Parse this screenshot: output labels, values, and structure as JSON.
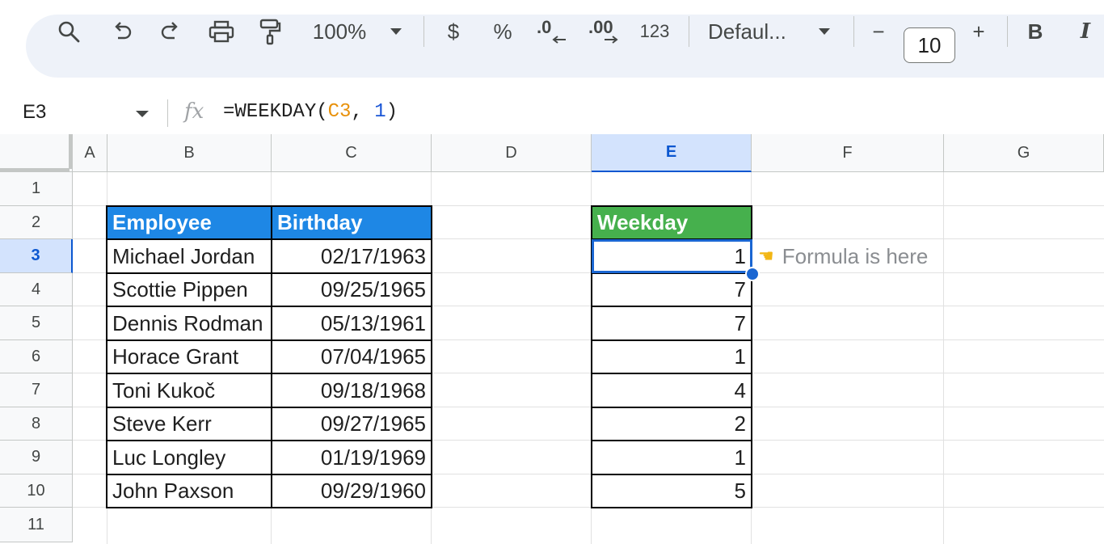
{
  "toolbar": {
    "zoom": "100%",
    "currency": "$",
    "percent": "%",
    "decrease_decimal": ".0",
    "increase_decimal": ".00",
    "number_format": "123",
    "font_family": "Defaul...",
    "minus": "−",
    "font_size": "10",
    "plus": "+",
    "bold": "B",
    "italic": "I"
  },
  "formula_bar": {
    "name_box": "E3",
    "fx": "fx",
    "formula_prefix": "=WEEKDAY(",
    "formula_ref": "C3",
    "formula_sep": ", ",
    "formula_arg": "1",
    "formula_suffix": ")"
  },
  "columns": [
    "A",
    "B",
    "C",
    "D",
    "E",
    "F",
    "G"
  ],
  "selected_column": "E",
  "rows": [
    "1",
    "2",
    "3",
    "4",
    "5",
    "6",
    "7",
    "8",
    "9",
    "10",
    "11"
  ],
  "selected_row": "3",
  "table": {
    "header_employee": "Employee",
    "header_birthday": "Birthday",
    "header_weekday": "Weekday",
    "employees": [
      "Michael Jordan",
      "Scottie Pippen",
      "Dennis Rodman",
      "Horace Grant",
      "Toni Kukoč",
      "Steve Kerr",
      "Luc Longley",
      "John Paxson"
    ],
    "birthdays": [
      "02/17/1963",
      "09/25/1965",
      "05/13/1961",
      "07/04/1965",
      "09/18/1968",
      "09/27/1965",
      "01/19/1969",
      "09/29/1960"
    ],
    "weekdays": [
      "1",
      "7",
      "7",
      "1",
      "4",
      "2",
      "1",
      "5"
    ]
  },
  "annotation": {
    "icon": "pointing-hand-icon",
    "text": "Formula is here"
  },
  "colors": {
    "header_blue": "#1e87e5",
    "header_green": "#46b04d",
    "selection": "#1a66d2"
  }
}
